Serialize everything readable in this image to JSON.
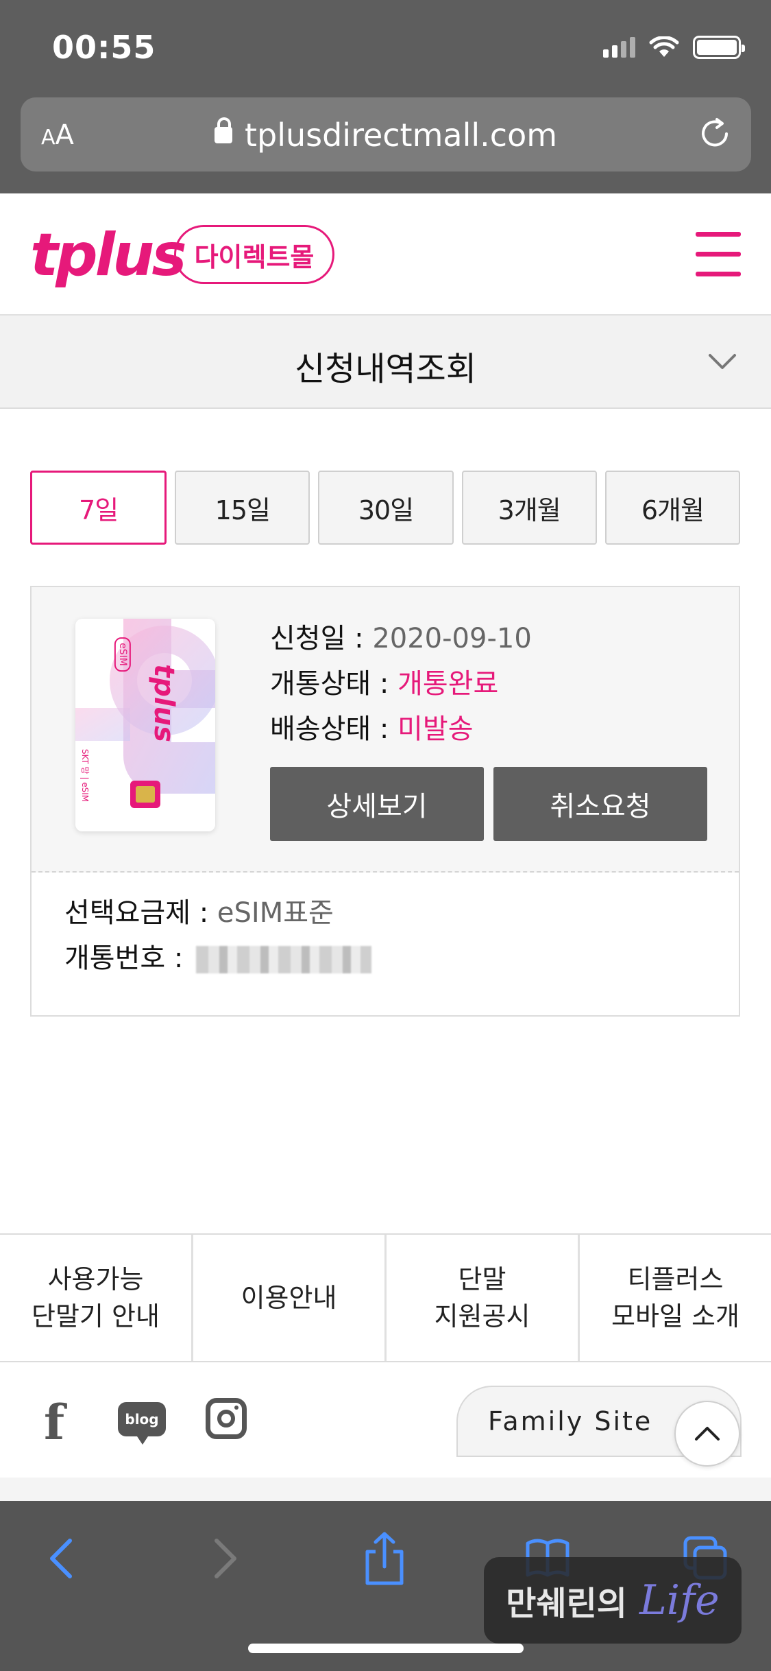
{
  "status_bar": {
    "time": "00:55"
  },
  "browser": {
    "aa_label_small": "A",
    "aa_label_large": "A",
    "url": "tplusdirectmall.com"
  },
  "header": {
    "logo_text": "tplus",
    "badge_text": "다이렉트몰"
  },
  "page": {
    "title": "신청내역조회"
  },
  "periods": [
    {
      "label": "7일",
      "active": true
    },
    {
      "label": "15일",
      "active": false
    },
    {
      "label": "30일",
      "active": false
    },
    {
      "label": "3개월",
      "active": false
    },
    {
      "label": "6개월",
      "active": false
    }
  ],
  "order": {
    "sim_text": "tplus",
    "sim_esim": "eSIM",
    "sim_side": "SKT 망 | eSIM",
    "apply_date_label": "신청일 : ",
    "apply_date": "2020-09-10",
    "activation_label": "개통상태 : ",
    "activation_status": "개통완료",
    "shipping_label": "배송상태 : ",
    "shipping_status": "미발송",
    "detail_button": "상세보기",
    "cancel_button": "취소요청",
    "plan_label": "선택요금제 : ",
    "plan_value": "eSIM표준",
    "number_label": "개통번호 : "
  },
  "footer": {
    "links": [
      "사용가능\n단말기 안내",
      "이용안내",
      "단말\n지원공시",
      "티플러스\n모바일 소개"
    ],
    "blog_label": "blog",
    "family_site": "Family Site"
  },
  "watermark": {
    "korean": "만쉐린의",
    "life": "Life"
  },
  "colors": {
    "brand": "#e6197a",
    "button_dark": "#5f5f5f",
    "browser_chrome": "#5e5e5e",
    "ios_blue": "#3b82f6"
  }
}
